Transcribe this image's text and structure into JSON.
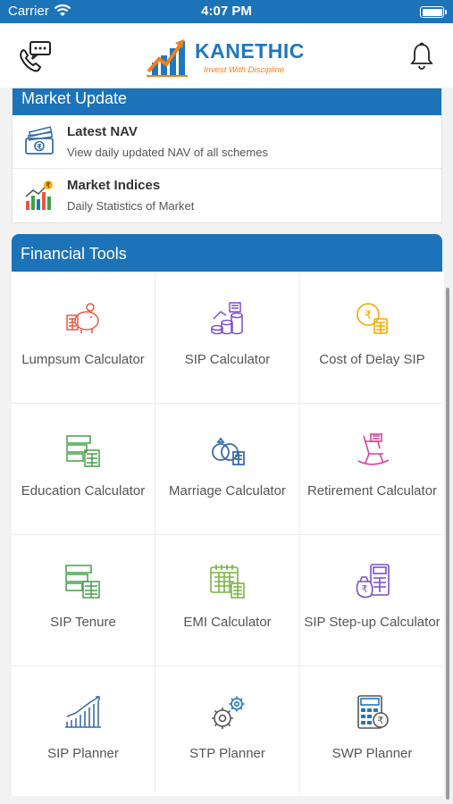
{
  "status_bar": {
    "carrier": "Carrier",
    "time": "4:07 PM"
  },
  "header": {
    "brand_name": "KANETHIC",
    "tagline": "Invest With Discipline",
    "icons": {
      "left": "chat-phone-icon",
      "right": "bell-icon"
    }
  },
  "market_update": {
    "title": "Market Update",
    "items": [
      {
        "title": "Latest NAV",
        "subtitle": "View daily updated NAV of all schemes",
        "icon": "money-stack-icon"
      },
      {
        "title": "Market Indices",
        "subtitle": "Daily Statistics of Market",
        "icon": "bar-chart-rupee-icon"
      }
    ]
  },
  "financial_tools": {
    "title": "Financial Tools",
    "tools": [
      {
        "label": "Lumpsum Calculator",
        "icon": "piggy-bank-calculator-icon"
      },
      {
        "label": "SIP Calculator",
        "icon": "coin-stacks-icon"
      },
      {
        "label": "Cost of Delay SIP",
        "icon": "rupee-coin-calculator-icon"
      },
      {
        "label": "Education Calculator",
        "icon": "education-calculator-icon"
      },
      {
        "label": "Marriage Calculator",
        "icon": "rings-calculator-icon"
      },
      {
        "label": "Retirement Calculator",
        "icon": "rocking-chair-icon"
      },
      {
        "label": "SIP Tenure",
        "icon": "tenure-calculator-icon"
      },
      {
        "label": "EMI Calculator",
        "icon": "calendar-calculator-icon"
      },
      {
        "label": "SIP Step-up Calculator",
        "icon": "money-bag-calculator-icon"
      },
      {
        "label": "SIP Planner",
        "icon": "growth-chart-icon"
      },
      {
        "label": "STP Planner",
        "icon": "gears-icon"
      },
      {
        "label": "SWP Planner",
        "icon": "calculator-rupee-icon"
      }
    ]
  },
  "colors": {
    "primary": "#1c73b8",
    "brand_orange": "#f07f17"
  }
}
